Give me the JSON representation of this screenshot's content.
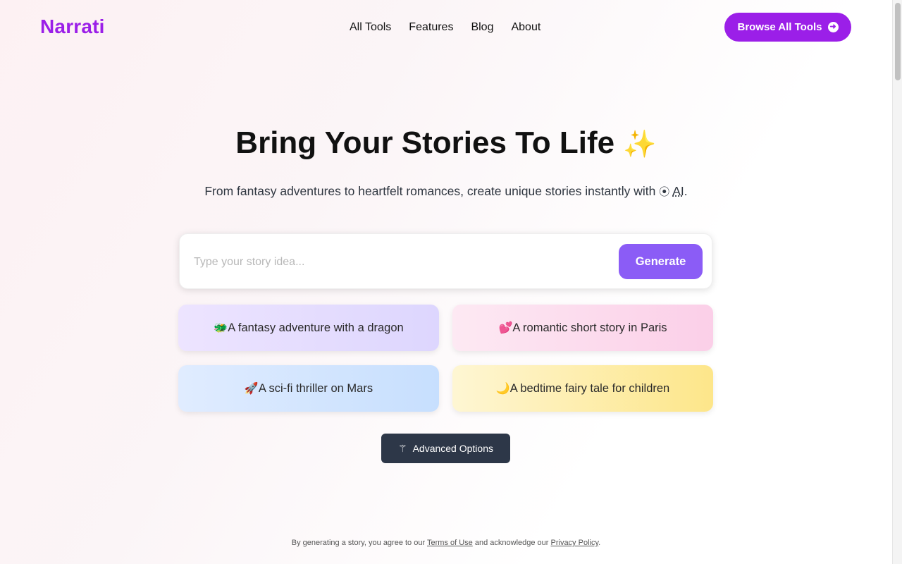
{
  "header": {
    "logo": "Narrati",
    "nav": [
      "All Tools",
      "Features",
      "Blog",
      "About"
    ],
    "browse_label": "Browse All Tools",
    "browse_icon": "arrow-right-circle-icon"
  },
  "hero": {
    "title": "Bring Your Stories To Life",
    "title_emoji": "✨",
    "subtitle_prefix": "From fantasy adventures to heartfelt romances, create unique stories instantly with",
    "subtitle_ai": "AI",
    "subtitle_suffix": "."
  },
  "prompt": {
    "placeholder": "Type your story idea...",
    "value": "",
    "generate_label": "Generate"
  },
  "ideas": [
    {
      "emoji": "🐲",
      "label": "A fantasy adventure with a dragon"
    },
    {
      "emoji": "💕",
      "label": "A romantic short story in Paris"
    },
    {
      "emoji": "🚀",
      "label": "A sci-fi thriller on Mars"
    },
    {
      "emoji": "🌙",
      "label": "A bedtime fairy tale for children"
    }
  ],
  "advanced": {
    "label": "Advanced Options",
    "icon": "magic-wand-icon"
  },
  "footer": {
    "prefix": "By generating a story, you agree to our",
    "terms": "Terms of Use",
    "middle": "and acknowledge our",
    "privacy": "Privacy Policy",
    "suffix": "."
  },
  "colors": {
    "brand": "#9b1fe8",
    "generate": "#8b5cf6",
    "advanced_bg": "#2d3748"
  }
}
